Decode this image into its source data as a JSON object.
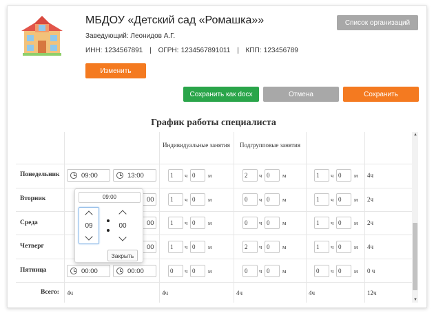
{
  "org": {
    "title": "МБДОУ «Детский сад «Ромашка»»",
    "head": "Заведующий: Леонидов А.Г.",
    "ids": "ИНН: 1234567891   |   ОГРН: 1234567891011   |   КПП: 123456789"
  },
  "buttons": {
    "org_list": "Список организаций",
    "edit": "Изменить",
    "save_docx": "Сохранить как docx",
    "cancel": "Отмена",
    "save": "Сохранить"
  },
  "schedule": {
    "title": "График работы специалиста",
    "headers": {
      "individual": "Индивидуальные занятия",
      "group": "Подгрупповые занятия"
    },
    "unit_h": "ч",
    "unit_m": "м",
    "rows": [
      {
        "day": "Понедельник",
        "start": "09:00",
        "end": "13:00",
        "ind_h": "1",
        "ind_m": "0",
        "grp_h": "2",
        "grp_m": "0",
        "oth_h": "1",
        "oth_m": "0",
        "total": "4ч"
      },
      {
        "day": "Вторник",
        "start": "",
        "end": "00",
        "ind_h": "1",
        "ind_m": "0",
        "grp_h": "0",
        "grp_m": "0",
        "oth_h": "1",
        "oth_m": "0",
        "total": "2ч"
      },
      {
        "day": "Среда",
        "start": "",
        "end": "00",
        "ind_h": "1",
        "ind_m": "0",
        "grp_h": "0",
        "grp_m": "0",
        "oth_h": "1",
        "oth_m": "0",
        "total": "2ч"
      },
      {
        "day": "Четверг",
        "start": "",
        "end": "00",
        "ind_h": "1",
        "ind_m": "0",
        "grp_h": "2",
        "grp_m": "0",
        "oth_h": "1",
        "oth_m": "0",
        "total": "4ч"
      },
      {
        "day": "Пятница",
        "start": "00:00",
        "end": "00:00",
        "ind_h": "0",
        "ind_m": "0",
        "grp_h": "0",
        "grp_m": "0",
        "oth_h": "0",
        "oth_m": "0",
        "total": "0 ч"
      }
    ],
    "totals": {
      "label": "Всего:",
      "c1": "4ч",
      "c2": "4ч",
      "c3": "4ч",
      "c4": "4ч",
      "c5": "12ч"
    }
  },
  "picker": {
    "value": "09:00",
    "hours": "09",
    "minutes": "00",
    "close": "Закрыть"
  }
}
